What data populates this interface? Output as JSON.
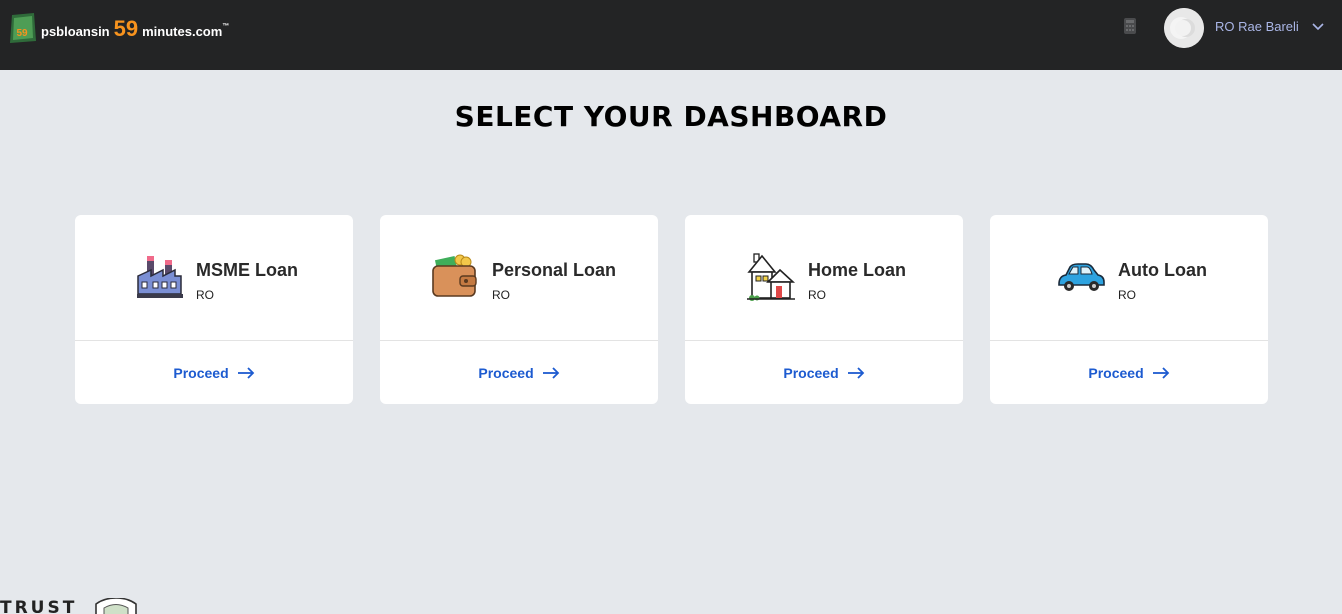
{
  "header": {
    "logo_prefix": "psbloansin",
    "logo_number": "59",
    "logo_domain": "minutes.com",
    "logo_tm": "™",
    "logo_badge_text": "59",
    "user_name": "RO Rae Bareli"
  },
  "page": {
    "title": "SELECT YOUR DASHBOARD"
  },
  "cards": [
    {
      "title": "MSME Loan",
      "subtitle": "RO",
      "action": "Proceed",
      "icon": "factory-icon"
    },
    {
      "title": "Personal Loan",
      "subtitle": "RO",
      "action": "Proceed",
      "icon": "wallet-icon"
    },
    {
      "title": "Home Loan",
      "subtitle": "RO",
      "action": "Proceed",
      "icon": "house-icon"
    },
    {
      "title": "Auto Loan",
      "subtitle": "RO",
      "action": "Proceed",
      "icon": "car-icon"
    }
  ],
  "footer": {
    "trust_label": "TRUST"
  },
  "colors": {
    "topbar": "#232425",
    "accent": "#1d5bd0",
    "logo_orange": "#f7931e",
    "page_bg": "#e5e8ec"
  }
}
